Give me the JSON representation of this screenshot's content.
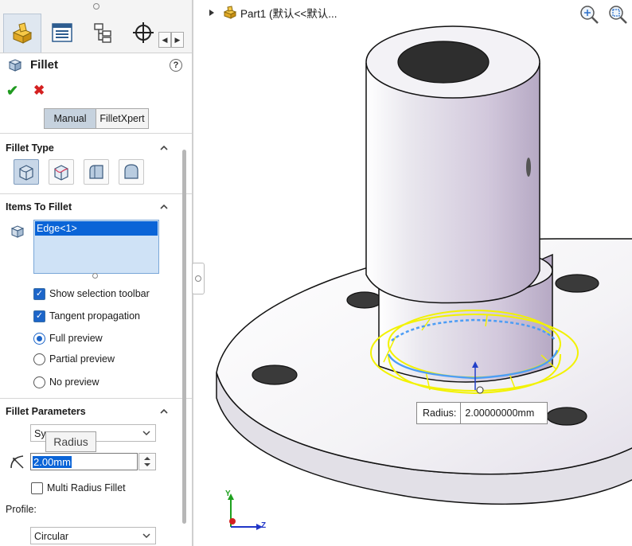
{
  "panel": {
    "title": "Fillet",
    "help_symbol": "?",
    "ok_symbol": "✔",
    "cancel_symbol": "✖",
    "mode_tabs": [
      "Manual",
      "FilletXpert"
    ],
    "nav_left": "◀",
    "nav_right": "▶",
    "icons": [
      "property-manager-icon",
      "feature-manager-icon",
      "configuration-manager-icon",
      "dimxpert-icon"
    ]
  },
  "fillet_type": {
    "title": "Fillet Type",
    "buttons": [
      "constant-size-fillet-icon",
      "variable-size-fillet-icon",
      "face-fillet-icon",
      "full-round-fillet-icon"
    ],
    "selected_index": 0
  },
  "items_to_fillet": {
    "title": "Items To Fillet",
    "items": [
      "Edge<1>"
    ],
    "options": {
      "show_selection_toolbar": {
        "label": "Show selection toolbar",
        "checked": true
      },
      "tangent_propagation": {
        "label": "Tangent propagation",
        "checked": true
      }
    },
    "preview": {
      "full": {
        "label": "Full preview",
        "selected": true
      },
      "partial": {
        "label": "Partial preview",
        "selected": false
      },
      "none": {
        "label": "No preview",
        "selected": false
      }
    }
  },
  "fillet_parameters": {
    "title": "Fillet Parameters",
    "method_value_visible": "Sy",
    "tooltip": "Radius",
    "radius_value": "2.00mm",
    "multi_radius": {
      "label": "Multi Radius Fillet",
      "checked": false
    },
    "profile_label": "Profile:",
    "profile_value": "Circular"
  },
  "viewport": {
    "tree_label": "Part1 (默认<<默认...",
    "radius_callout": {
      "label": "Radius:",
      "value": "2.00000000mm"
    },
    "triad": {
      "y": "Y",
      "z": "Z"
    },
    "colors": {
      "selection": "#f2f200",
      "edge_highlight": "#4d9df5",
      "panel_select": "#0a64d7"
    }
  }
}
